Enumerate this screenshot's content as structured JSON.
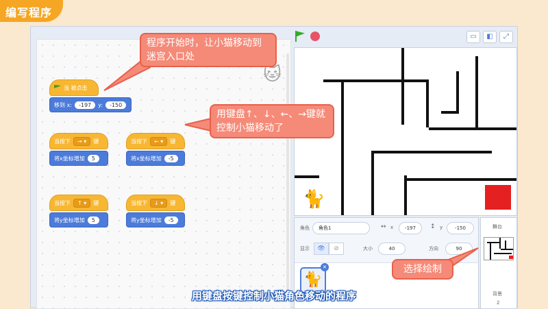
{
  "header": {
    "title": "编写程序"
  },
  "code_blocks": {
    "start": {
      "hat_label": "当 被点击",
      "goto_label": "移到 x:",
      "x": "-197",
      "y_label": "y:",
      "y": "-150"
    },
    "right": {
      "when": "当按下",
      "key": "→ ▾",
      "key_suffix": "键",
      "action": "将x坐标增加",
      "value": "5"
    },
    "left": {
      "when": "当按下",
      "key": "← ▾",
      "key_suffix": "键",
      "action": "将x坐标增加",
      "value": "-5"
    },
    "up": {
      "when": "当按下",
      "key": "↑ ▾",
      "key_suffix": "键",
      "action": "将y坐标增加",
      "value": "5"
    },
    "down": {
      "when": "当按下",
      "key": "↓ ▾",
      "key_suffix": "键",
      "action": "将y坐标增加",
      "value": "-5"
    }
  },
  "sprite_info": {
    "sprite_label": "角色",
    "sprite_name": "角色1",
    "x_label": "x",
    "x": "-197",
    "y_label": "y",
    "y": "-150",
    "show_label": "显示",
    "size_label": "大小",
    "size": "40",
    "direction_label": "方向",
    "direction": "90"
  },
  "stage_panel": {
    "title": "舞台",
    "backdrop_label": "背景",
    "backdrop_count": "2"
  },
  "callouts": {
    "start": "程序开始时，让小猫移动到迷宫入口处",
    "keys": "用键盘↑、↓、←、→键就控制小猫移动了",
    "paint": "选择绘制"
  },
  "subtitle": "用键盘按键控制小猫角色移动的程序",
  "colors": {
    "callout": "#f58a78",
    "event_block": "#f7b733",
    "motion_block": "#4c7bd9",
    "target": "#e52020"
  }
}
